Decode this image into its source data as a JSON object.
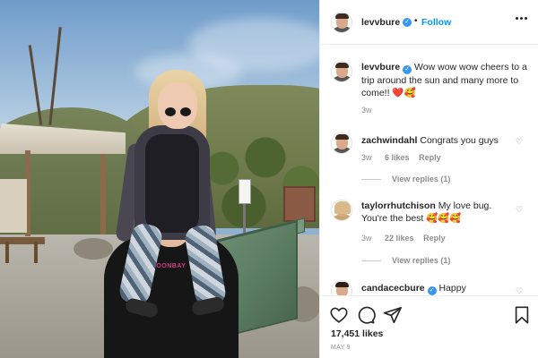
{
  "post": {
    "author": {
      "username": "levvbure",
      "verified": true,
      "follow_label": "Follow",
      "separator": "•"
    },
    "caption": {
      "username": "levvbure",
      "text": "Wow wow wow cheers to a trip around the sun and many more to come!! ❤️🥰",
      "age": "3w"
    },
    "photo": {
      "shirt_print": "MOONBAY"
    },
    "comments": [
      {
        "username": "zachwindahl",
        "verified": false,
        "text": "Congrats you guys",
        "age": "3w",
        "likes": "6 likes",
        "reply_label": "Reply",
        "view_replies": "View replies (1)"
      },
      {
        "username": "taylorrhutchison",
        "verified": false,
        "text": "My love bug. You're the best 🥰🥰🥰",
        "age": "3w",
        "likes": "22 likes",
        "reply_label": "Reply",
        "view_replies": "View replies (1)"
      },
      {
        "username": "candacecbure",
        "verified": true,
        "text": "Happy"
      }
    ],
    "actions": {
      "icons": [
        "heart-icon",
        "comment-icon",
        "share-icon",
        "bookmark-icon"
      ],
      "likes_count": "17,451 likes",
      "date": "MAY 9"
    }
  },
  "colors": {
    "accent": "#0095f6",
    "verified_badge": "#3897f0",
    "text": "#262626",
    "muted": "#8e8e8e"
  }
}
